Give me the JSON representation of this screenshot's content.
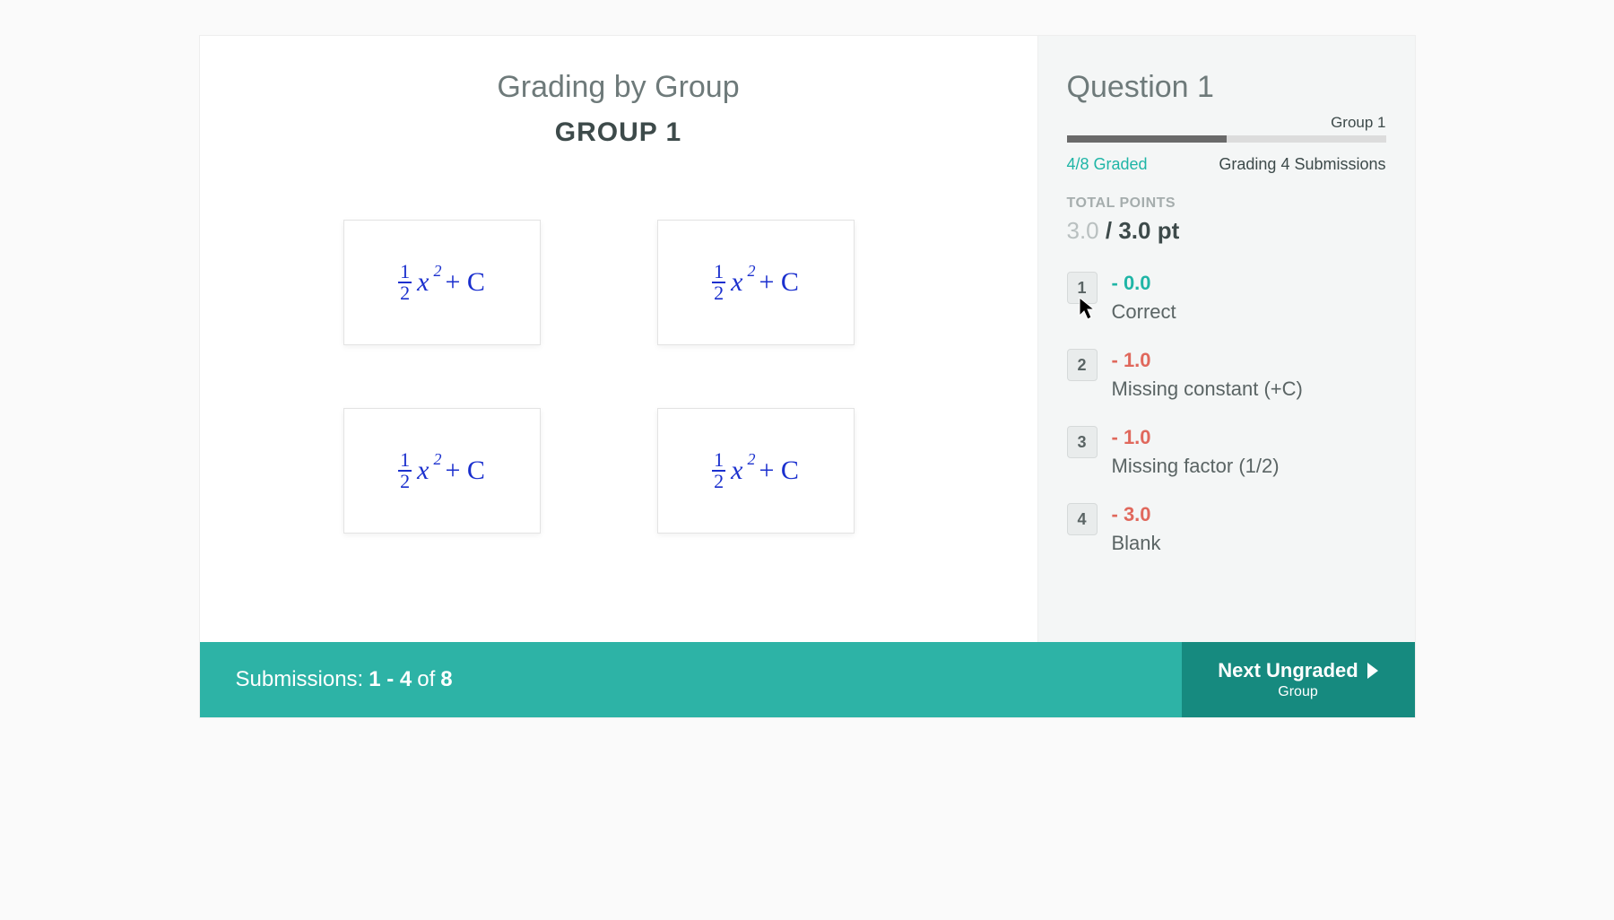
{
  "main": {
    "title": "Grading by Group",
    "group_name": "GROUP 1",
    "submissions": [
      {
        "answer_text": "½ x² + C"
      },
      {
        "answer_text": "½ x² + C"
      },
      {
        "answer_text": "½ x² + C"
      },
      {
        "answer_text": "½ x² + C"
      }
    ]
  },
  "sidebar": {
    "question_title": "Question 1",
    "group_label": "Group 1",
    "progress_percent": 50,
    "graded_text": "4/8 Graded",
    "grading_text": "Grading 4 Submissions",
    "total_points_label": "TOTAL POINTS",
    "points_earned": "3.0",
    "points_divider": " / ",
    "points_max": "3.0 pt",
    "rubric": [
      {
        "key": "1",
        "points": "- 0.0",
        "color": "green",
        "desc": "Correct"
      },
      {
        "key": "2",
        "points": "- 1.0",
        "color": "red",
        "desc": "Missing constant (+C)"
      },
      {
        "key": "3",
        "points": "- 1.0",
        "color": "red",
        "desc": "Missing factor (1/2)"
      },
      {
        "key": "4",
        "points": "- 3.0",
        "color": "red",
        "desc": "Blank"
      }
    ]
  },
  "footer": {
    "label": "Submissions:",
    "range": "1 - 4",
    "of": "of",
    "total": "8",
    "next_label": "Next Ungraded",
    "next_sub": "Group"
  }
}
